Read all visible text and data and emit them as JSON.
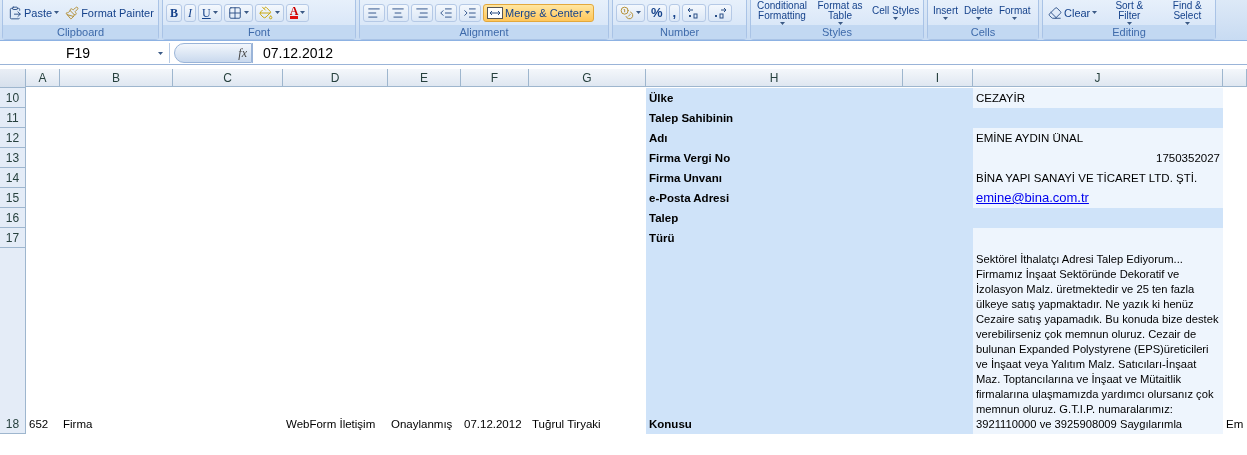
{
  "ribbon": {
    "groups": [
      {
        "label": "Clipboard",
        "buttons": [
          {
            "kind": "paste",
            "label": "Paste",
            "dropdown": true
          },
          {
            "kind": "painter",
            "label": "Format Painter"
          }
        ]
      },
      {
        "label": "Font",
        "buttons": [
          {
            "kind": "bold",
            "label": "B"
          },
          {
            "kind": "italic",
            "label": "I"
          },
          {
            "kind": "underline",
            "label": "U",
            "dropdown": true
          },
          {
            "kind": "borders",
            "dropdown": true
          },
          {
            "kind": "fill",
            "dropdown": true
          },
          {
            "kind": "font_color",
            "label": "A",
            "dropdown": true
          }
        ]
      },
      {
        "label": "Alignment",
        "buttons": [
          {
            "kind": "align_left"
          },
          {
            "kind": "align_center"
          },
          {
            "kind": "align_right"
          },
          {
            "kind": "indent_less"
          },
          {
            "kind": "indent_more"
          },
          {
            "kind": "merge",
            "label": "Merge & Center",
            "dropdown": true,
            "highlighted": true
          }
        ]
      },
      {
        "label": "Number",
        "buttons": [
          {
            "kind": "currency",
            "dropdown": true
          },
          {
            "kind": "symbol",
            "label": "%"
          },
          {
            "kind": "symbol",
            "label": ","
          },
          {
            "kind": "decimal_more"
          },
          {
            "kind": "decimal_less"
          }
        ]
      },
      {
        "label": "Styles",
        "buttons": [
          {
            "kind": "tall",
            "label": "Conditional Formatting",
            "dropdown": true
          },
          {
            "kind": "tall",
            "label": "Format as Table",
            "dropdown": true
          },
          {
            "kind": "tall",
            "label": "Cell Styles",
            "dropdown": true
          }
        ]
      },
      {
        "label": "Cells",
        "buttons": [
          {
            "kind": "tall",
            "label": "Insert",
            "dropdown": true
          },
          {
            "kind": "tall",
            "label": "Delete",
            "dropdown": true
          },
          {
            "kind": "tall",
            "label": "Format",
            "dropdown": true
          }
        ]
      },
      {
        "label": "Editing",
        "buttons": [
          {
            "kind": "clear",
            "label": "Clear",
            "dropdown": true
          },
          {
            "kind": "tall",
            "label": "Sort & Filter",
            "dropdown": true
          },
          {
            "kind": "tall",
            "label": "Find & Select",
            "dropdown": true
          }
        ]
      }
    ]
  },
  "formula_bar": {
    "name_box": "F19",
    "function_label": "fx",
    "value": "07.12.2012"
  },
  "table": {
    "columns": [
      "A",
      "B",
      "C",
      "D",
      "E",
      "F",
      "G",
      "H",
      "I",
      "J"
    ],
    "rows": [
      {
        "number": "10",
        "cells": [
          {
            "kind": "empty"
          },
          {
            "kind": "empty"
          },
          {
            "kind": "empty"
          },
          {
            "kind": "empty"
          },
          {
            "kind": "empty"
          },
          {
            "kind": "empty"
          },
          {
            "kind": "empty"
          },
          {
            "kind": "label",
            "text": "Ülke"
          },
          {
            "kind": "band"
          },
          {
            "kind": "value",
            "text": "CEZAYİR"
          }
        ]
      },
      {
        "number": "11",
        "cells": [
          {
            "kind": "empty"
          },
          {
            "kind": "empty"
          },
          {
            "kind": "empty"
          },
          {
            "kind": "empty"
          },
          {
            "kind": "empty"
          },
          {
            "kind": "empty"
          },
          {
            "kind": "empty"
          },
          {
            "kind": "label",
            "text": "Talep Sahibinin"
          },
          {
            "kind": "band"
          },
          {
            "kind": "band"
          }
        ]
      },
      {
        "number": "12",
        "cells": [
          {
            "kind": "empty"
          },
          {
            "kind": "empty"
          },
          {
            "kind": "empty"
          },
          {
            "kind": "empty"
          },
          {
            "kind": "empty"
          },
          {
            "kind": "empty"
          },
          {
            "kind": "empty"
          },
          {
            "kind": "label",
            "text": "Adı"
          },
          {
            "kind": "band"
          },
          {
            "kind": "value",
            "text": "EMİNE AYDIN ÜNAL"
          }
        ]
      },
      {
        "number": "13",
        "cells": [
          {
            "kind": "empty"
          },
          {
            "kind": "empty"
          },
          {
            "kind": "empty"
          },
          {
            "kind": "empty"
          },
          {
            "kind": "empty"
          },
          {
            "kind": "empty"
          },
          {
            "kind": "empty"
          },
          {
            "kind": "label",
            "text": "Firma Vergi No"
          },
          {
            "kind": "band"
          },
          {
            "kind": "number",
            "text": "1750352027"
          }
        ]
      },
      {
        "number": "14",
        "cells": [
          {
            "kind": "empty"
          },
          {
            "kind": "empty"
          },
          {
            "kind": "empty"
          },
          {
            "kind": "empty"
          },
          {
            "kind": "empty"
          },
          {
            "kind": "empty"
          },
          {
            "kind": "empty"
          },
          {
            "kind": "label",
            "text": "Firma Unvanı"
          },
          {
            "kind": "band"
          },
          {
            "kind": "value",
            "text": "BİNA YAPI SANAYİ VE TİCARET LTD. ŞTİ."
          }
        ]
      },
      {
        "number": "15",
        "cells": [
          {
            "kind": "empty"
          },
          {
            "kind": "empty"
          },
          {
            "kind": "empty"
          },
          {
            "kind": "empty"
          },
          {
            "kind": "empty"
          },
          {
            "kind": "empty"
          },
          {
            "kind": "empty"
          },
          {
            "kind": "label",
            "text": "e-Posta Adresi"
          },
          {
            "kind": "band"
          },
          {
            "kind": "link",
            "text": "emine@bina.com.tr"
          }
        ]
      },
      {
        "number": "16",
        "cells": [
          {
            "kind": "empty"
          },
          {
            "kind": "empty"
          },
          {
            "kind": "empty"
          },
          {
            "kind": "empty"
          },
          {
            "kind": "empty"
          },
          {
            "kind": "empty"
          },
          {
            "kind": "empty"
          },
          {
            "kind": "label",
            "text": "Talep"
          },
          {
            "kind": "band"
          },
          {
            "kind": "band"
          }
        ]
      },
      {
        "number": "17",
        "cells": [
          {
            "kind": "empty"
          },
          {
            "kind": "empty"
          },
          {
            "kind": "empty"
          },
          {
            "kind": "empty"
          },
          {
            "kind": "empty"
          },
          {
            "kind": "empty"
          },
          {
            "kind": "empty"
          },
          {
            "kind": "label",
            "text": "Türü"
          },
          {
            "kind": "band"
          },
          {
            "kind": "value"
          }
        ]
      },
      {
        "number": "18",
        "cells": [
          {
            "kind": "plain",
            "text": "652"
          },
          {
            "kind": "plain",
            "text": "Firma"
          },
          {
            "kind": "empty"
          },
          {
            "kind": "plain",
            "text": "WebForm İletişim"
          },
          {
            "kind": "plain",
            "text": "Onaylanmış"
          },
          {
            "kind": "plain",
            "text": "07.12.2012"
          },
          {
            "kind": "plain",
            "text": "Tuğrul Tiryaki"
          },
          {
            "kind": "label",
            "text": "Konusu"
          },
          {
            "kind": "band"
          },
          {
            "kind": "paragraph",
            "text": "Sektörel İthalatçı Adresi Talep Ediyorum... Firmamız İnşaat Sektöründe Dekoratif ve İzolasyon Malz. üretmektedir ve 25 ten fazla ülkeye satış yapmaktadır. Ne yazık ki henüz Cezaire satış yapamadık. Bu konuda bize destek verebilirseniz çok memnun oluruz. Cezair de bulunan Expanded Polystyrene (EPS)üreticileri ve İnşaat veya Yalıtım Malz. Satıcıları-İnşaat Maz. Toptancılarına ve İnşaat ve Mütaitlik firmalarına ulaşmamızda yardımcı olursanız çok memnun oluruz. G.T.I.P. numaralarımız: 3921110000 ve 3925908009 Saygılarımla"
          },
          {
            "kind": "plain",
            "text": "Em"
          }
        ]
      }
    ]
  }
}
